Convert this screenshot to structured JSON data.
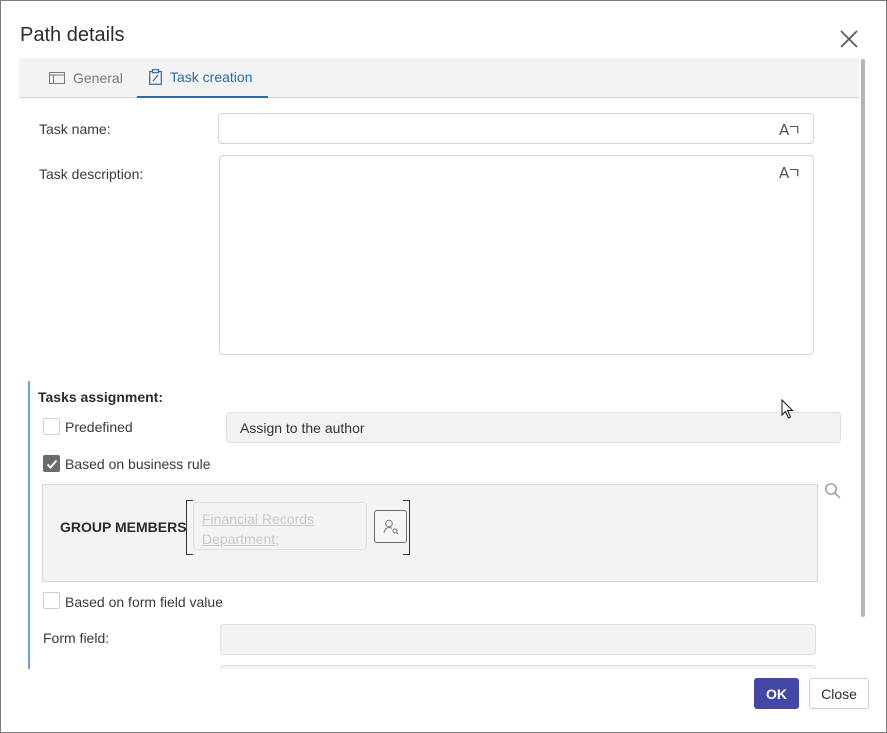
{
  "dialog": {
    "title": "Path details"
  },
  "tabs": [
    {
      "label": "General",
      "icon": "panel-icon",
      "active": false
    },
    {
      "label": "Task creation",
      "icon": "clipboard-edit-icon",
      "active": true
    }
  ],
  "form": {
    "task_name_label": "Task name:",
    "task_name_value": "",
    "task_description_label": "Task description:",
    "task_description_value": "",
    "translate_icon": "Aㄱ"
  },
  "assignment": {
    "title": "Tasks assignment:",
    "predefined_label": "Predefined",
    "predefined_checked": false,
    "predefined_value": "Assign to the author",
    "business_rule_label": "Based on business rule",
    "business_rule_checked": true,
    "group_members_label": "GROUP MEMBERS",
    "group_members_value_line1": "Financial Records ",
    "group_members_value_line2": "Department;",
    "form_field_value_label": "Based on form field value",
    "form_field_value_checked": false,
    "form_field_label": "Form field:",
    "form_field_value": ""
  },
  "footer": {
    "ok_label": "OK",
    "close_label": "Close"
  },
  "colors": {
    "accent": "#2a6aa8",
    "primary_button": "#4347a5",
    "section_border": "#6aa6da"
  }
}
